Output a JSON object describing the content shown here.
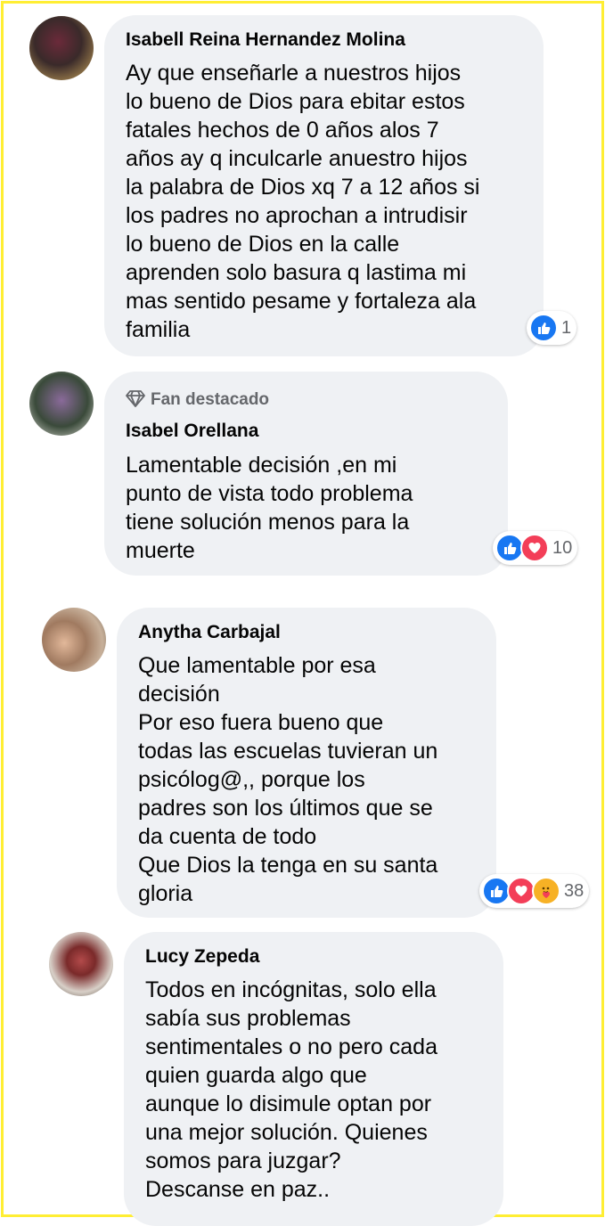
{
  "comments": [
    {
      "author": "Isabell Reina Hernandez Molina",
      "text": "Ay que enseñarle a nuestros hijos\nlo bueno de Dios para ebitar estos\nfatales hechos de 0 años alos 7\naños ay q inculcarle anuestro hijos\nla palabra de Dios xq 7 a 12 años si\nlos padres no aprochan a intrudisir\nlo bueno de Dios en la calle\naprenden solo basura q lastima mi\nmas sentido pesame y fortaleza ala\nfamilia",
      "reaction_icons": [
        "like-icon"
      ],
      "reaction_count": "1"
    },
    {
      "badge": "Fan destacado",
      "badge_icon": "diamond-icon",
      "author": "Isabel Orellana",
      "text": "Lamentable decisión ,en mi\npunto de vista todo problema\ntiene solución menos para la\nmuerte",
      "reaction_icons": [
        "like-icon",
        "love-icon"
      ],
      "reaction_count": "10"
    },
    {
      "author": "Anytha Carbajal",
      "text": "Que lamentable por esa\ndecisión\nPor eso fuera bueno que\ntodas las escuelas tuvieran un\npsicólog@,, porque los\npadres son los últimos que se\nda cuenta de todo\nQue Dios la tenga en su santa\ngloria",
      "reaction_icons": [
        "like-icon",
        "love-icon",
        "care-icon"
      ],
      "reaction_count": "38"
    },
    {
      "author": "Lucy Zepeda",
      "text": "Todos en incógnitas, solo ella\nsabía sus problemas\nsentimentales o no pero cada\nquien guarda algo que\naunque lo disimule optan por\nuna mejor solución. Quienes\nsomos para juzgar?\nDescanse en paz..",
      "reaction_icons": [],
      "reaction_count": ""
    }
  ],
  "colors": {
    "bubble": "#eff1f4",
    "text": "#050505",
    "secondary": "#65676b",
    "like": "#1877f2",
    "love": "#f33e58",
    "care": "#f7b125",
    "frame": "#ffee33"
  }
}
